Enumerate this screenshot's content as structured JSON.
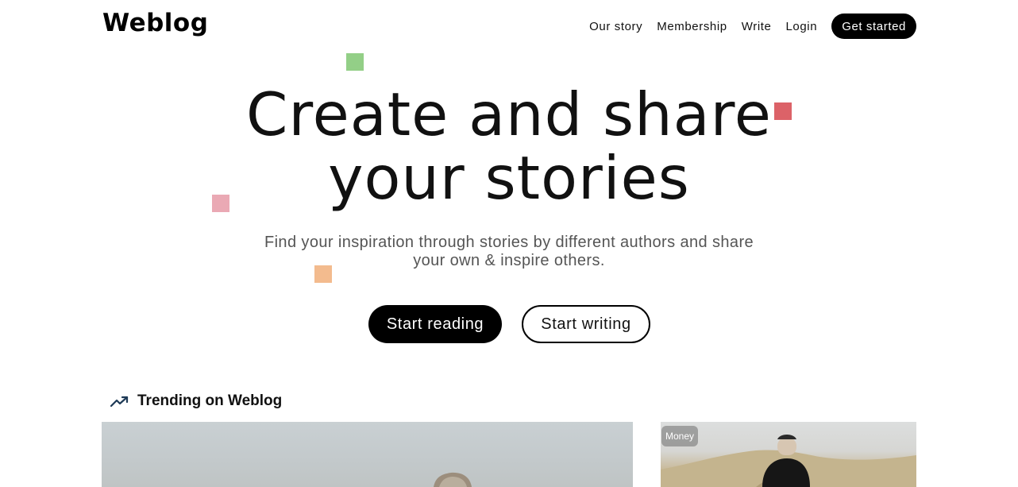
{
  "brand": {
    "logo_text": "Weblog"
  },
  "nav": {
    "links": [
      {
        "label": "Our story"
      },
      {
        "label": "Membership"
      },
      {
        "label": "Write"
      },
      {
        "label": "Login"
      }
    ],
    "cta_label": "Get started"
  },
  "hero": {
    "title_line1": "Create and share",
    "title_line2": "your stories",
    "subtitle": "Find your inspiration through stories by different authors and share your own & inspire others.",
    "primary_button": "Start reading",
    "secondary_button": "Start writing"
  },
  "decor_colors": {
    "green": "#93cf87",
    "red": "#dc6268",
    "pink": "#eaa9b4",
    "orange": "#f3bb8e"
  },
  "trending": {
    "icon": "trending-up-icon",
    "title": "Trending on Weblog",
    "cards": [
      {
        "badge": ""
      },
      {
        "badge": "Money"
      }
    ]
  }
}
